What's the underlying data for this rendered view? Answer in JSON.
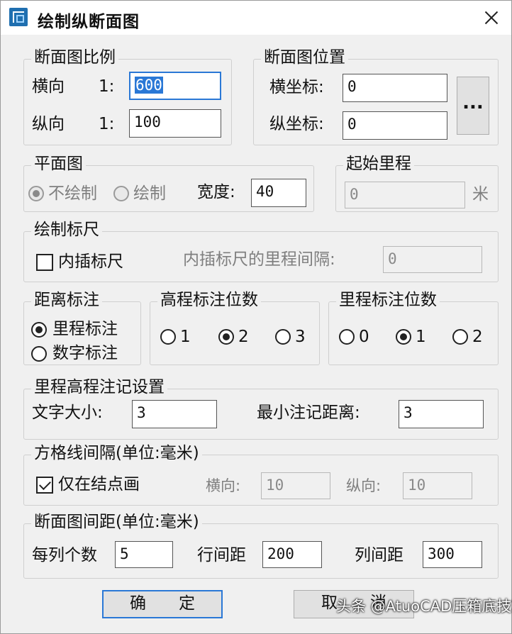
{
  "window": {
    "title": "绘制纵断面图"
  },
  "scale_group": {
    "legend": "断面图比例",
    "horiz_label": "横向",
    "vert_label": "纵向",
    "ratio_prefix": "1:",
    "horiz_value": "600",
    "vert_value": "100"
  },
  "position_group": {
    "legend": "断面图位置",
    "x_label": "横坐标:",
    "y_label": "纵坐标:",
    "x_value": "0",
    "y_value": "0",
    "pick_button": "..."
  },
  "plan_group": {
    "legend": "平面图",
    "no_draw": "不绘制",
    "draw": "绘制",
    "width_label": "宽度:",
    "width_value": "40",
    "selected": "no_draw"
  },
  "start_mileage_group": {
    "legend": "起始里程",
    "value": "0",
    "unit": "米"
  },
  "ruler_group": {
    "legend": "绘制标尺",
    "interp_label": "内插标尺",
    "interp_checked": false,
    "interval_label": "内插标尺的里程间隔:",
    "interval_value": "0"
  },
  "distance_group": {
    "legend": "距离标注",
    "mileage": "里程标注",
    "digit": "数字标注",
    "selected": "mileage"
  },
  "elevation_digits_group": {
    "legend": "高程标注位数",
    "options": [
      "1",
      "2",
      "3"
    ],
    "selected": "2"
  },
  "mileage_digits_group": {
    "legend": "里程标注位数",
    "options": [
      "0",
      "1",
      "2"
    ],
    "selected": "1"
  },
  "annotation_group": {
    "legend": "里程高程注记设置",
    "font_size_label": "文字大小:",
    "font_size_value": "3",
    "min_dist_label": "最小注记距离:",
    "min_dist_value": "3"
  },
  "grid_group": {
    "legend": "方格线间隔(单位:毫米)",
    "nodes_only_label": "仅在结点画",
    "nodes_only_checked": true,
    "horiz_label": "横向:",
    "horiz_value": "10",
    "vert_label": "纵向:",
    "vert_value": "10"
  },
  "spacing_group": {
    "legend": "断面图间距(单位:毫米)",
    "per_col_label": "每列个数",
    "per_col_value": "5",
    "row_gap_label": "行间距",
    "row_gap_value": "200",
    "col_gap_label": "列间距",
    "col_gap_value": "300"
  },
  "buttons": {
    "ok": "确　　定",
    "cancel": "取　　消"
  },
  "watermark": "头条 @AtuoCAD压箱底技巧"
}
